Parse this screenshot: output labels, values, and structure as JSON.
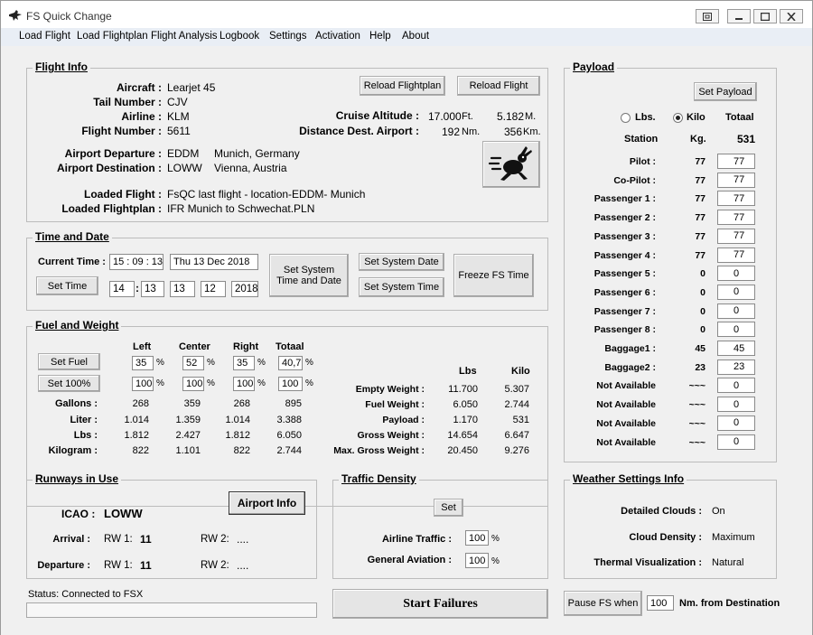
{
  "window": {
    "title": "FS Quick Change"
  },
  "menu": [
    "Load Flight",
    "Load Flightplan",
    "Flight Analysis",
    "Logbook",
    "Settings",
    "Activation",
    "Help",
    "About"
  ],
  "flight_info": {
    "title": "Flight Info",
    "aircraft_label": "Aircraft :",
    "aircraft": "Learjet 45",
    "tail_label": "Tail Number :",
    "tail": "CJV",
    "airline_label": "Airline :",
    "airline": "KLM",
    "flight_label": "Flight Number :",
    "flight": "5611",
    "dep_label": "Airport Departure :",
    "dep_code": "EDDM",
    "dep_city": "Munich, Germany",
    "dest_label": "Airport Destination :",
    "dest_code": "LOWW",
    "dest_city": "Vienna, Austria",
    "loaded_flight_label": "Loaded Flight :",
    "loaded_flight": "FsQC last flight - location-EDDM- Munich",
    "loaded_plan_label": "Loaded Flightplan :",
    "loaded_plan": "IFR Munich to Schwechat.PLN",
    "reload_plan_button": "Reload Flightplan",
    "reload_flight_button": "Reload Flight",
    "cruise_label": "Cruise Altitude :",
    "cruise_ft": "17.000",
    "ft_unit": "Ft.",
    "cruise_m": "5.182",
    "m_unit": "M.",
    "dist_label": "Distance Dest. Airport :",
    "dist_nm": "192",
    "nm_unit": "Nm.",
    "dist_km": "356",
    "km_unit": "Km."
  },
  "time_date": {
    "title": "Time and Date",
    "current_label": "Current Time :",
    "current_time": "15 : 09 : 13",
    "current_date": "Thu   13 Dec   2018",
    "set_time_button": "Set Time",
    "hour": "14",
    "colon": ":",
    "minute": "13",
    "day": "13",
    "month": "12",
    "year": "2018",
    "set_system_button": "Set System Time and Date",
    "set_system_date_button": "Set System Date",
    "set_system_time_button": "Set System Time",
    "freeze_button": "Freeze FS Time"
  },
  "fuel": {
    "title": "Fuel and  Weight",
    "set_fuel_button": "Set Fuel",
    "set_100_button": "Set 100%",
    "headers": [
      "Left",
      "Center",
      "Right",
      "Totaal"
    ],
    "percent": [
      "35",
      "52",
      "35",
      "40,7"
    ],
    "percent_100": [
      "100",
      "100",
      "100",
      "100"
    ],
    "pct_sign": "%",
    "rows": [
      {
        "label": "Gallons :",
        "values": [
          "268",
          "359",
          "268",
          "895"
        ]
      },
      {
        "label": "Liter :",
        "values": [
          "1.014",
          "1.359",
          "1.014",
          "3.388"
        ]
      },
      {
        "label": "Lbs :",
        "values": [
          "1.812",
          "2.427",
          "1.812",
          "6.050"
        ]
      },
      {
        "label": "Kilogram :",
        "values": [
          "822",
          "1.101",
          "822",
          "2.744"
        ]
      }
    ],
    "weight_headers": [
      "Lbs",
      "Kilo"
    ],
    "weights": [
      {
        "label": "Empty Weight :",
        "lbs": "11.700",
        "kilo": "5.307"
      },
      {
        "label": "Fuel Weight :",
        "lbs": "6.050",
        "kilo": "2.744"
      },
      {
        "label": "Payload :",
        "lbs": "1.170",
        "kilo": "531"
      },
      {
        "label": "Gross Weight :",
        "lbs": "14.654",
        "kilo": "6.647"
      },
      {
        "label": "Max. Gross Weight :",
        "lbs": "20.450",
        "kilo": "9.276"
      }
    ]
  },
  "runways": {
    "title": "Runways in Use",
    "icao_label": "ICAO :",
    "icao": "LOWW",
    "airport_info_button": "Airport Info",
    "arrival_label": "Arrival :",
    "departure_label": "Departure :",
    "rw1_label": "RW 1:",
    "rw2_label": "RW 2:",
    "arrival_rw1": "11",
    "arrival_rw2": "....",
    "departure_rw1": "11",
    "departure_rw2": "...."
  },
  "traffic": {
    "title": "Traffic Density",
    "set_button": "Set",
    "airline_label": "Airline Traffic :",
    "airline_value": "100",
    "ga_label": "General Aviation :",
    "ga_value": "100",
    "pct": "%"
  },
  "status": {
    "text": "Status: Connected to FSX"
  },
  "start_failures_button": "Start Failures",
  "payload": {
    "title": "Payload",
    "set_payload_button": "Set Payload",
    "lbs_label": "Lbs.",
    "kilo_label": "Kilo",
    "totaal_label": "Totaal",
    "station_header": "Station",
    "kg_header": "Kg.",
    "total": "531",
    "stations": [
      {
        "name": "Pilot :",
        "kg": "77",
        "input": "77"
      },
      {
        "name": "Co-Pilot :",
        "kg": "77",
        "input": "77"
      },
      {
        "name": "Passenger 1 :",
        "kg": "77",
        "input": "77"
      },
      {
        "name": "Passenger 2 :",
        "kg": "77",
        "input": "77"
      },
      {
        "name": "Passenger 3 :",
        "kg": "77",
        "input": "77"
      },
      {
        "name": "Passenger 4 :",
        "kg": "77",
        "input": "77"
      },
      {
        "name": "Passenger 5 :",
        "kg": "0",
        "input": "0"
      },
      {
        "name": "Passenger 6 :",
        "kg": "0",
        "input": "0"
      },
      {
        "name": "Passenger 7 :",
        "kg": "0",
        "input": "0"
      },
      {
        "name": "Passenger 8 :",
        "kg": "0",
        "input": "0"
      },
      {
        "name": "Baggage1 :",
        "kg": "45",
        "input": "45"
      },
      {
        "name": "Baggage2 :",
        "kg": "23",
        "input": "23"
      },
      {
        "name": "Not Available",
        "kg": "~~~",
        "input": "0"
      },
      {
        "name": "Not Available",
        "kg": "~~~",
        "input": "0"
      },
      {
        "name": "Not Available",
        "kg": "~~~",
        "input": "0"
      },
      {
        "name": "Not Available",
        "kg": "~~~",
        "input": "0"
      }
    ]
  },
  "weather": {
    "title": "Weather Settings Info",
    "clouds_label": "Detailed Clouds :",
    "clouds": "On",
    "density_label": "Cloud Density :",
    "density": "Maximum",
    "thermal_label": "Thermal Visualization :",
    "thermal": "Natural"
  },
  "pause": {
    "button": "Pause FS when",
    "value": "100",
    "suffix": "Nm. from Destination"
  }
}
